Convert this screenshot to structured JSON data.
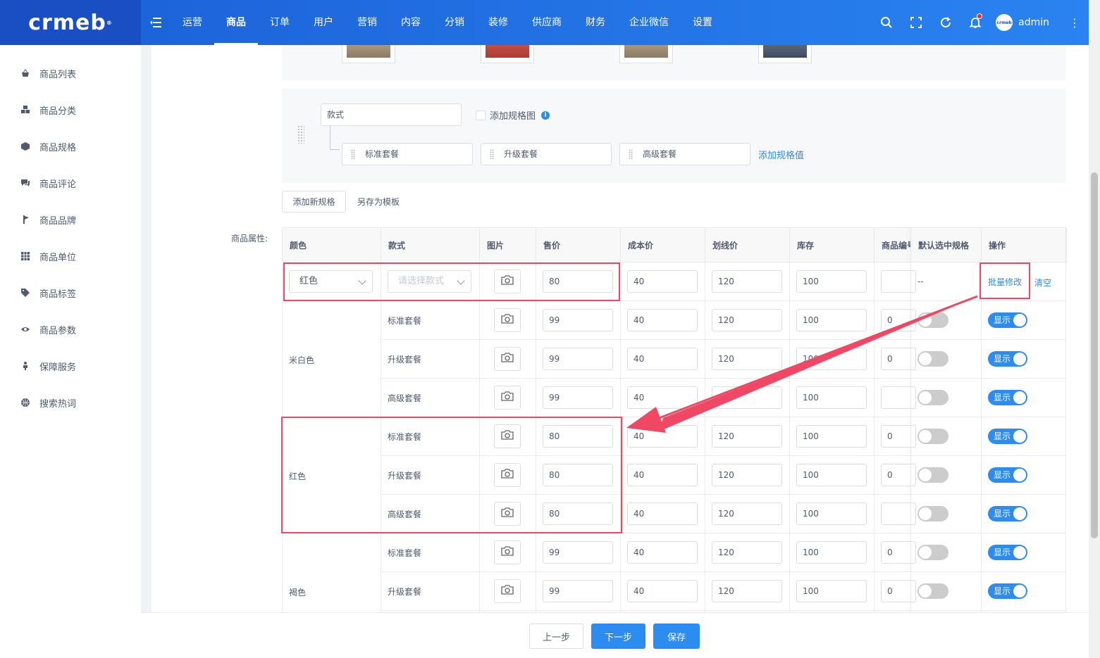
{
  "brand": {
    "logo_text": "crmeb",
    "logo_mark": "®"
  },
  "header": {
    "nav": [
      "运营",
      "商品",
      "订单",
      "用户",
      "营销",
      "内容",
      "分销",
      "装修",
      "供应商",
      "财务",
      "企业微信",
      "设置"
    ],
    "active_nav": "商品",
    "avatar_text": "crmeb",
    "username": "admin"
  },
  "sidebar": {
    "items": [
      {
        "label": "商品列表",
        "icon": "shopping-basket-icon"
      },
      {
        "label": "商品分类",
        "icon": "cubes-icon"
      },
      {
        "label": "商品规格",
        "icon": "cube-icon"
      },
      {
        "label": "商品评论",
        "icon": "comments-icon"
      },
      {
        "label": "商品品牌",
        "icon": "brand-icon"
      },
      {
        "label": "商品单位",
        "icon": "grid-icon"
      },
      {
        "label": "商品标签",
        "icon": "tag-icon"
      },
      {
        "label": "商品参数",
        "icon": "eye-icon"
      },
      {
        "label": "保障服务",
        "icon": "person-icon"
      },
      {
        "label": "搜索热词",
        "icon": "globe-icon"
      }
    ]
  },
  "spec": {
    "name": "款式",
    "add_image_label": "添加规格图",
    "values": [
      "标准套餐",
      "升级套餐",
      "高级套餐"
    ],
    "add_value_link": "添加规格值",
    "add_new_spec": "添加新规格",
    "save_as_template": "另存为模板"
  },
  "attributes": {
    "label": "商品属性:",
    "columns": [
      "颜色",
      "款式",
      "图片",
      "售价",
      "成本价",
      "划线价",
      "库存",
      "商品编号",
      "默认选中规格",
      "操作"
    ],
    "batch_row": {
      "color_select": "红色",
      "style_placeholder": "请选择款式",
      "price": "80",
      "cost": "40",
      "list_price": "120",
      "stock": "100",
      "default_mark": "--",
      "batch_edit": "批量修改",
      "clear": "清空"
    },
    "groups": [
      {
        "color": "米白色",
        "rows": [
          {
            "style": "标准套餐",
            "price": "99",
            "cost": "40",
            "list_price": "120",
            "stock": "100",
            "code": "0"
          },
          {
            "style": "升级套餐",
            "price": "99",
            "cost": "40",
            "list_price": "120",
            "stock": "100",
            "code": "0"
          },
          {
            "style": "高级套餐",
            "price": "99",
            "cost": "40",
            "list_price": "120",
            "stock": "100",
            "code": ""
          }
        ]
      },
      {
        "color": "红色",
        "rows": [
          {
            "style": "标准套餐",
            "price": "80",
            "cost": "40",
            "list_price": "120",
            "stock": "100",
            "code": "0"
          },
          {
            "style": "升级套餐",
            "price": "80",
            "cost": "40",
            "list_price": "120",
            "stock": "100",
            "code": "0"
          },
          {
            "style": "高级套餐",
            "price": "80",
            "cost": "40",
            "list_price": "120",
            "stock": "100",
            "code": ""
          }
        ]
      },
      {
        "color": "褐色",
        "rows": [
          {
            "style": "标准套餐",
            "price": "99",
            "cost": "40",
            "list_price": "120",
            "stock": "100",
            "code": "0"
          },
          {
            "style": "升级套餐",
            "price": "99",
            "cost": "40",
            "list_price": "120",
            "stock": "100",
            "code": "0"
          }
        ]
      }
    ],
    "show_label": "显示"
  },
  "footer": {
    "prev": "上一步",
    "next": "下一步",
    "save": "保存"
  },
  "colors": {
    "header": "#1a5fd6",
    "primary": "#2d8cf0",
    "annotation": "#f04864"
  }
}
